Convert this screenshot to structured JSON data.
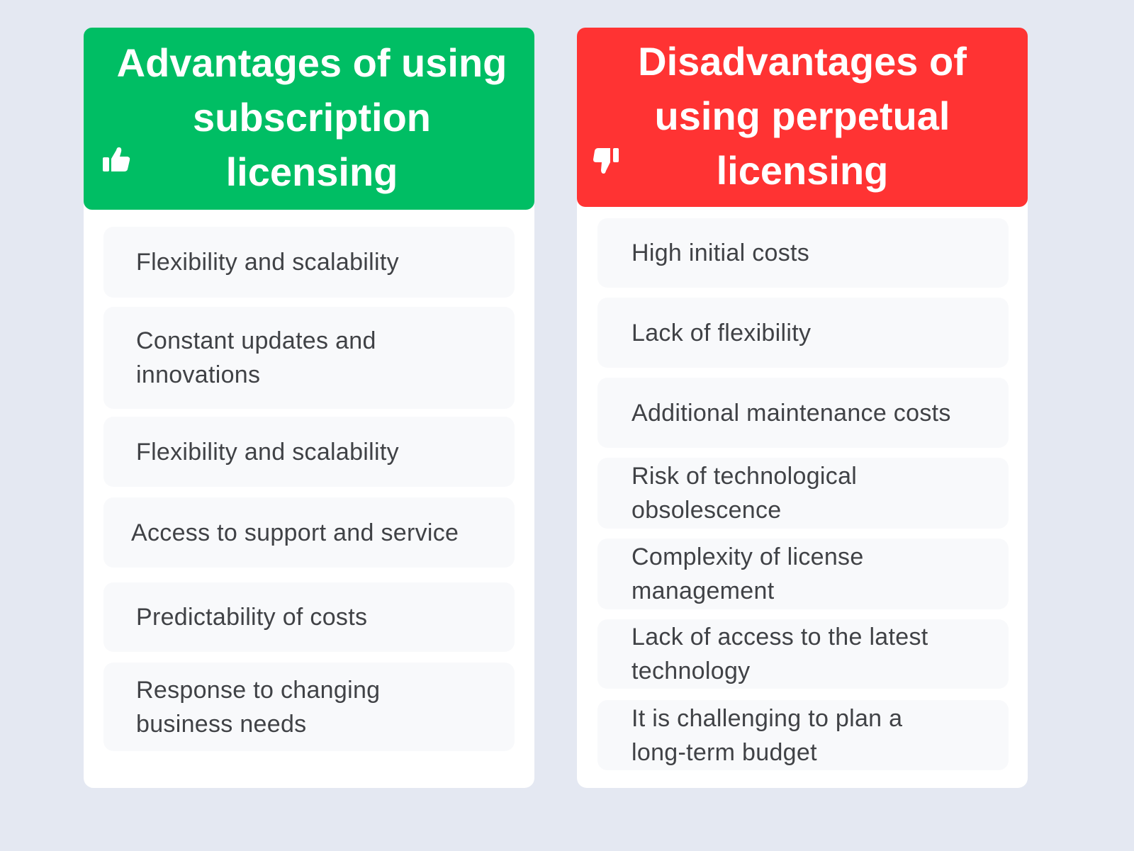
{
  "colors": {
    "background": "#e4e8f2",
    "advantages_header": "#00be64",
    "disadvantages_header": "#ff3333",
    "item_background": "#f8f9fb",
    "item_text": "#404246"
  },
  "advantages": {
    "icon": "thumbs-up-icon",
    "title": "Advantages of using subscription licensing",
    "items": [
      "Flexibility and scalability",
      "Constant updates and innovations",
      "Flexibility and scalability",
      "Access to support and service",
      "Predictability of costs",
      "Response to changing business needs"
    ]
  },
  "disadvantages": {
    "icon": "thumbs-down-icon",
    "title": "Disadvantages of using perpetual licensing",
    "items": [
      "High initial costs",
      "Lack of flexibility",
      "Additional maintenance costs",
      "Risk of technological obsolescence",
      "Complexity of license management",
      "Lack of access to the latest technology",
      "It is challenging to plan a long-term budget"
    ]
  }
}
